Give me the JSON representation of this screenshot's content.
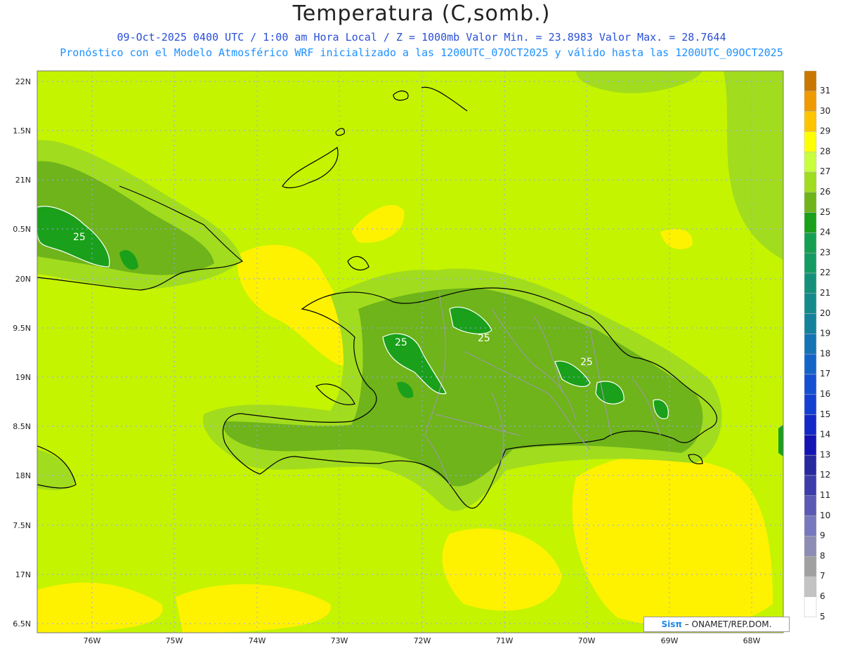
{
  "header": {
    "title": "Temperatura (C,somb.)",
    "line1": "09-Oct-2025  0400 UTC / 1:00 am Hora Local / Z = 1000mb   Valor Min. = 23.8983  Valor Max. = 28.7644",
    "line2": "Pronóstico con el Modelo Atmosférico WRF inicializado a las 1200UTC_07OCT2025 y válido hasta las  1200UTC_09OCT2025"
  },
  "axes": {
    "lat_labels": [
      "22N",
      "1.5N",
      "21N",
      "0.5N",
      "20N",
      "9.5N",
      "19N",
      "8.5N",
      "18N",
      "7.5N",
      "17N",
      "6.5N"
    ],
    "lon_labels": [
      "76W",
      "75W",
      "74W",
      "73W",
      "72W",
      "71W",
      "70W",
      "69W",
      "68W"
    ]
  },
  "contour_labels": [
    "25",
    "25",
    "25",
    "25"
  ],
  "colorbar": {
    "labels": [
      "31",
      "30",
      "29",
      "28",
      "27",
      "26",
      "25",
      "24",
      "23",
      "22",
      "21",
      "20",
      "19",
      "18",
      "17",
      "16",
      "15",
      "14",
      "13",
      "12",
      "11",
      "10",
      "9",
      "8",
      "7",
      "6",
      "5"
    ],
    "colors": [
      "#c87800",
      "#ee9a00",
      "#ffc400",
      "#ffff00",
      "#c8ff3c",
      "#a0dc20",
      "#6eb41a",
      "#1aa01a",
      "#14a050",
      "#149b64",
      "#14907a",
      "#148a8c",
      "#14829b",
      "#1473b4",
      "#1464c8",
      "#1450d2",
      "#1440d2",
      "#1428c8",
      "#1414b4",
      "#2828a0",
      "#3c3caa",
      "#5a5ab4",
      "#7878be",
      "#8c8cb4",
      "#a0a0a0",
      "#c3c3c3",
      "#ffffff"
    ]
  },
  "credit": {
    "brand": "Sisπ",
    "text": " – ONAMET/REP.DOM."
  }
}
